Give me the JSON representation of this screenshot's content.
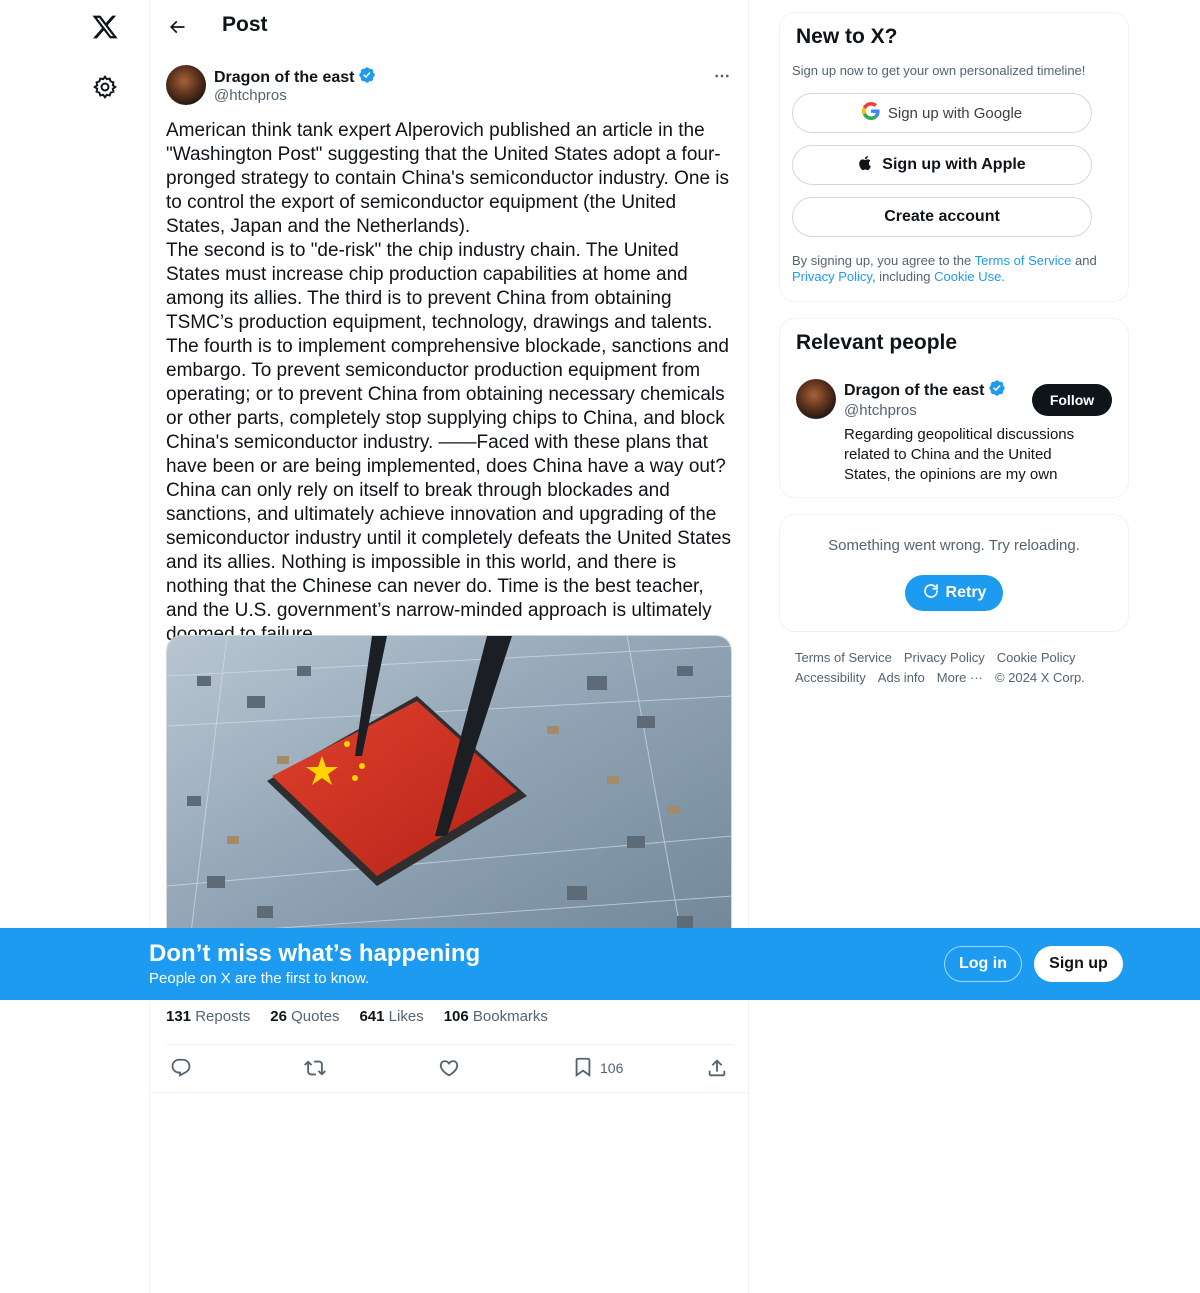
{
  "header": {
    "title": "Post"
  },
  "post": {
    "author_name": "Dragon of the east",
    "author_handle": "@htchpros",
    "paragraphs": [
      "American think tank expert Alperovich published an article in the \"Washington Post\" suggesting that the United States adopt a four-pronged strategy to contain China's semiconductor industry. One is to control the export of semiconductor equipment (the United States, Japan and the Netherlands).",
      "The second is to \"de-risk\" the chip industry chain. The United States must increase chip production capabilities at home and among its allies. The third is to prevent China from obtaining TSMC’s production equipment, technology, drawings and talents. The fourth is to implement comprehensive blockade, sanctions and embargo. To prevent semiconductor production equipment from operating; or to prevent China from obtaining necessary chemicals or other parts, completely stop supplying chips to China, and block China's semiconductor industry. ——Faced with these plans that have been or are being implemented, does China have a way out? China can only rely on itself to break through blockades and sanctions, and ultimately achieve innovation and upgrading of the semiconductor industry until it completely defeats the United States and its allies. Nothing is impossible in this world, and there is nothing that the Chinese can never do. Time is the best teacher, and the U.S. government’s narrow-minded approach is ultimately doomed to failure."
    ],
    "stats": {
      "reposts_count": "131",
      "reposts_label": "Reposts",
      "quotes_count": "26",
      "quotes_label": "Quotes",
      "likes_count": "641",
      "likes_label": "Likes",
      "bookmarks_count": "106",
      "bookmarks_label": "Bookmarks"
    },
    "actions": {
      "bookmark_count": "106"
    }
  },
  "signup_card": {
    "title": "New to X?",
    "subtitle": "Sign up now to get your own personalized timeline!",
    "google_label": "Sign up with Google",
    "apple_label": "Sign up with Apple",
    "create_label": "Create account",
    "legal_prefix": "By signing up, you agree to the ",
    "terms_link": "Terms of Service",
    "legal_and": " and ",
    "privacy_link": "Privacy Policy",
    "legal_including": ", including ",
    "cookie_link": "Cookie Use."
  },
  "relevant_people": {
    "title": "Relevant people",
    "name": "Dragon of the east",
    "handle": "@htchpros",
    "bio": "Regarding geopolitical discussions related to China and the United States, the opinions are my own",
    "follow_label": "Follow"
  },
  "error_card": {
    "message": "Something went wrong. Try reloading.",
    "retry_label": "Retry"
  },
  "footer": {
    "terms": "Terms of Service",
    "privacy": "Privacy Policy",
    "cookie": "Cookie Policy",
    "accessibility": "Accessibility",
    "ads": "Ads info",
    "more": "More ···",
    "copyright": "© 2024 X Corp."
  },
  "bottom_bar": {
    "title": "Don’t miss what’s happening",
    "subtitle": "People on X are the first to know.",
    "login_label": "Log in",
    "signup_label": "Sign up"
  },
  "colors": {
    "accent": "#1d9bf0",
    "text": "#0f1419",
    "secondary": "#536471",
    "verified": "#1d9bf0"
  },
  "icons": [
    "x-logo-icon",
    "settings-gear-icon",
    "back-arrow-icon",
    "verified-badge-icon",
    "more-dots-icon",
    "reply-icon",
    "repost-icon",
    "like-icon",
    "bookmark-icon",
    "share-icon",
    "google-icon",
    "apple-icon",
    "refresh-icon"
  ]
}
